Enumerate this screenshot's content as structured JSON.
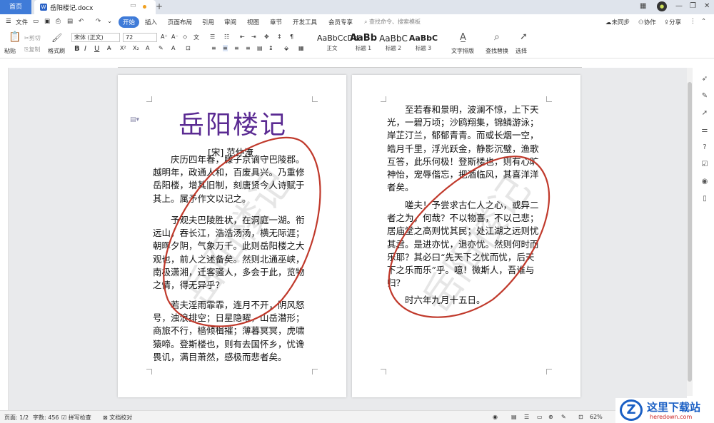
{
  "tabbar": {
    "home": "首页",
    "doc_tab": "岳阳楼记.docx",
    "doc_badge": "W",
    "new_tab": "+"
  },
  "menu": {
    "file": "文件",
    "items": [
      "开始",
      "插入",
      "页面布局",
      "引用",
      "审阅",
      "视图",
      "章节",
      "开发工具",
      "会员专享"
    ],
    "search": "查找命令、搜索模板",
    "right": [
      "未同步",
      "协作",
      "分享"
    ]
  },
  "ribbon": {
    "paste": "粘贴",
    "cut": "剪切",
    "copy": "复制",
    "format_painter": "格式刷",
    "font_name": "宋体 (正文)",
    "font_size": "72",
    "styles": [
      {
        "preview": "AaBbCcDd",
        "name": "正文"
      },
      {
        "preview": "AaBb",
        "name": "标题 1"
      },
      {
        "preview": "AaBbC",
        "name": "标题 2"
      },
      {
        "preview": "AaBbC",
        "name": "标题 3"
      }
    ],
    "text_layout": "文字排版",
    "find_replace": "查找替换",
    "select": "选择"
  },
  "document": {
    "title": "岳阳楼记",
    "author": "[宋] 范仲淹",
    "page1": [
      [
        "庆历四年春，滕子京谪守巴陵郡。",
        "越明年，政通人和，百废具兴。乃重修",
        "岳阳楼，增其旧制，刻唐贤今人诗赋于",
        "其上。属予作文以记之。"
      ],
      [
        "予观夫巴陵胜状，在洞庭一湖。衔",
        "远山，吞长江，浩浩汤汤，横无际涯；",
        "朝晖夕阴，气象万千。此则岳阳楼之大",
        "观也，前人之述备矣。然则北通巫峡，",
        "南极潇湘，迁客骚人，多会于此，览物",
        "之情，得无异乎？"
      ],
      [
        "若夫淫雨霏霏，连月不开，阴风怒",
        "号，浊浪排空；日星隐曜，山岳潜形；",
        "商旅不行，樯倾楫摧；薄暮冥冥，虎啸",
        "猿啼。登斯楼也，则有去国怀乡，忧谗",
        "畏讥，满目萧然，感极而悲者矣。"
      ]
    ],
    "page2": [
      [
        "至若春和景明，波澜不惊，上下天",
        "光，一碧万顷；沙鸥翔集，锦鳞游泳；",
        "岸芷汀兰，郁郁青青。而或长烟一空，",
        "皓月千里，浮光跃金，静影沉璧，渔歌",
        "互答，此乐何极！登斯楼也，则有心旷",
        "神怡，宠辱偕忘，把酒临风，其喜洋洋",
        "者矣。"
      ],
      [
        "嗟夫！予尝求古仁人之心，或异二",
        "者之为，何哉？不以物喜，不以己悲；",
        "居庙堂之高则忧其民；处江湖之远则忧",
        "其君。是进亦忧，退亦忧。然则何时而",
        "乐耶？其必曰“先天下之忧而忧，后天",
        "下之乐而乐”乎。噫！微斯人，吾谁与",
        "归？"
      ],
      [
        "时六年九月十五日。"
      ]
    ],
    "watermark": "岳阳楼记"
  },
  "status": {
    "page": "页面: 1/2",
    "words": "字数: 456",
    "spell": "拼写检查",
    "proof": "文档校对",
    "zoom": "62%"
  },
  "logo": {
    "mark": "Z",
    "name": "这里下载站",
    "url": "heredown.com"
  },
  "colors": {
    "accent": "#3f7bd8",
    "title": "#5a2a92",
    "ink": "#c0392b"
  }
}
